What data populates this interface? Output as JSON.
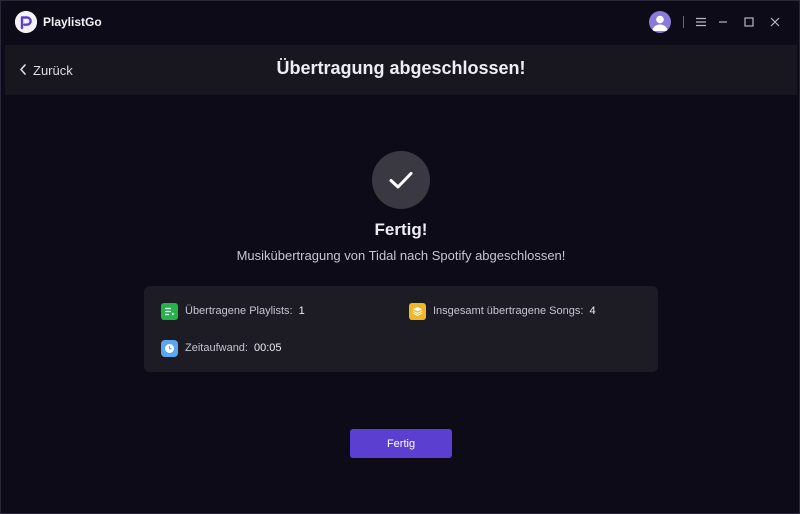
{
  "app": {
    "name": "PlaylistGo"
  },
  "header": {
    "back_label": "Zurück",
    "title": "Übertragung abgeschlossen!"
  },
  "result": {
    "title": "Fertig!",
    "subtitle": "Musikübertragung von Tidal nach Spotify abgeschlossen!"
  },
  "stats": {
    "playlists_label": "Übertragene Playlists:",
    "playlists_value": "1",
    "songs_label": "Insgesamt übertragene Songs:",
    "songs_value": "4",
    "time_label": "Zeitaufwand:",
    "time_value": "00:05"
  },
  "button": {
    "done_label": "Fertig"
  },
  "colors": {
    "accent": "#5b3fd1",
    "playlist_icon": "#22b34a",
    "songs_icon": "#f0b72a",
    "time_icon": "#5aa7f0"
  }
}
